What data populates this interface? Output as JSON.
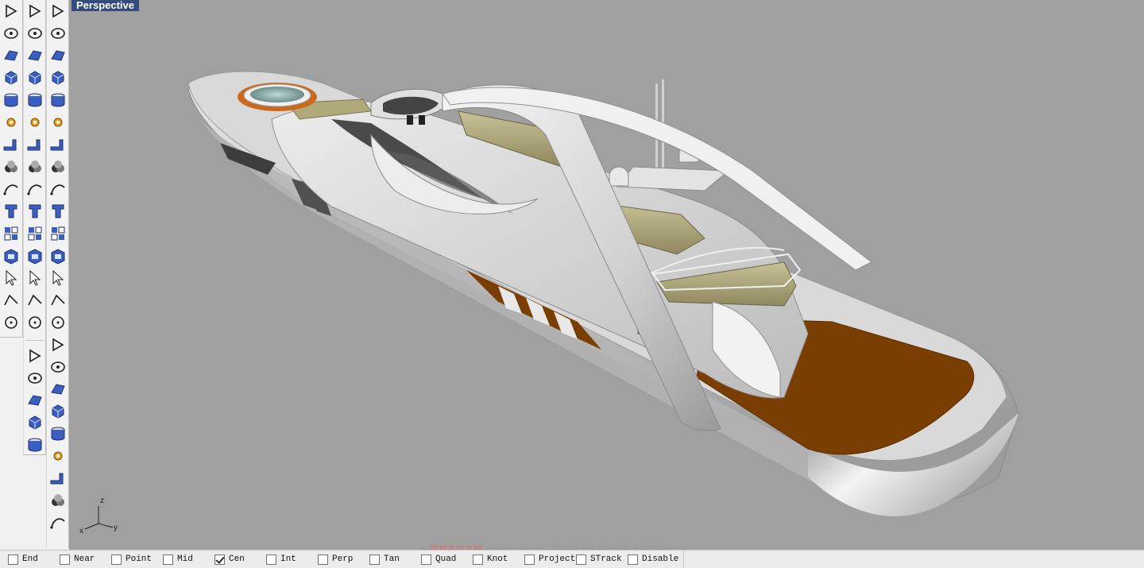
{
  "viewport": {
    "title": "Perspective",
    "background": "#a0a0a0",
    "axes": {
      "x": "x",
      "y": "y",
      "z": "z"
    }
  },
  "colors": {
    "hull": "#d4d4d4",
    "deck_wood": "#7a3d02",
    "upholstery": "#b0a97a",
    "title_bar": "#344b7c",
    "icon_blue": "#3a5fc0"
  },
  "toolbars": {
    "column1": [
      "select-arrow-icon",
      "polyline-icon",
      "circle-icon",
      "polygon-icon",
      "ellipse-point-icon",
      "surface-patch-icon",
      "box-solid-icon",
      "cylinder-icon",
      "settings-gear-icon",
      "extrude-icon",
      "boolean-icon",
      "curve-tool-icon",
      "text-icon",
      "group-icon",
      "solid-box-icon"
    ],
    "column2": [
      "point-icon",
      "curve-icon",
      "ellipse-icon",
      "rectangle-icon",
      "fillet-icon",
      "rotate-icon",
      "sphere-icon",
      "plane-icon",
      "explode-icon",
      "extrude-edge-icon",
      "boolean-union-icon",
      "arc-icon",
      "scale-icon",
      "move-icon",
      "ground-plane-icon",
      "cube-color-icon",
      "offset-icon",
      "gears-icon",
      "render-box-icon",
      "walkabout-icon"
    ],
    "column3": [
      "network-icon",
      "dimension-icon",
      "array-icon",
      "loft-icon",
      "box-edit-icon",
      "mirror-icon",
      "diamond-icon",
      "flatten-icon",
      "point-cloud-icon",
      "bend-icon",
      "transform-icon",
      "grid-array-icon",
      "polar-array-icon",
      "project-icon",
      "node-icon",
      "layer-icon",
      "split-icon",
      "twist-icon",
      "taper-icon",
      "shear-icon",
      "skew-icon",
      "flow-icon",
      "cage-icon",
      "render-icon"
    ]
  },
  "statusbar": {
    "snaps": [
      {
        "label": "End",
        "checked": false
      },
      {
        "label": "Near",
        "checked": false
      },
      {
        "label": "Point",
        "checked": false
      },
      {
        "label": "Mid",
        "checked": false
      },
      {
        "label": "Cen",
        "checked": true
      },
      {
        "label": "Int",
        "checked": false
      },
      {
        "label": "Perp",
        "checked": false
      },
      {
        "label": "Tan",
        "checked": false
      },
      {
        "label": "Quad",
        "checked": false
      },
      {
        "label": "Knot",
        "checked": false
      },
      {
        "label": "Project",
        "checked": false
      },
      {
        "label": "STrack",
        "checked": false
      },
      {
        "label": "Disable",
        "checked": false
      }
    ]
  },
  "watermark": {
    "site_name": "学犀牛中文网",
    "url": "xuexiniu.com",
    "slogan": "- 国内最大的Rhino技术交流平台"
  }
}
